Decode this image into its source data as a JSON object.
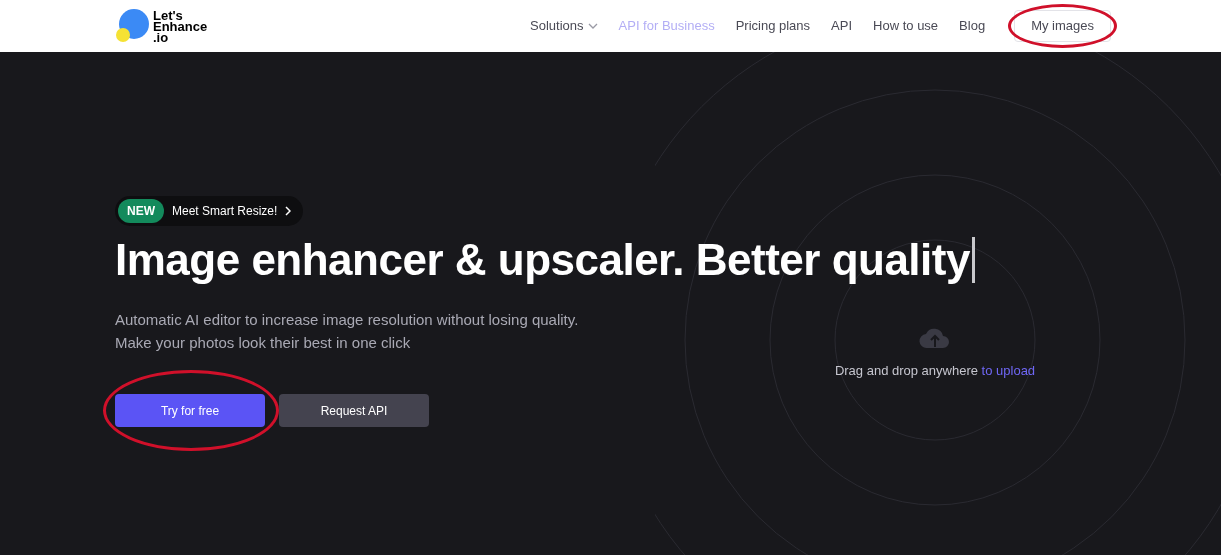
{
  "logo": {
    "text": "Let's\nEnhance\n.io"
  },
  "nav": [
    {
      "label": "Solutions",
      "kind": "dropdown",
      "selected": false
    },
    {
      "label": "API for Business",
      "kind": "link",
      "selected": true
    },
    {
      "label": "Pricing plans",
      "kind": "link",
      "selected": false
    },
    {
      "label": "API",
      "kind": "link",
      "selected": false
    },
    {
      "label": "How to use",
      "kind": "link",
      "selected": false
    },
    {
      "label": "Blog",
      "kind": "link",
      "selected": false
    },
    {
      "label": "My images",
      "kind": "button",
      "selected": false
    }
  ],
  "hero": {
    "badge": {
      "tag": "NEW",
      "text": "Meet Smart Resize!"
    },
    "title": "Image enhancer & upscaler. Better quality",
    "description": [
      "Automatic AI editor to increase image resolution without losing quality.",
      "Make your photos look their best in one click"
    ],
    "buttons": [
      {
        "label": "Try for free",
        "kind": "primary"
      },
      {
        "label": "Request API",
        "kind": "secondary"
      }
    ]
  },
  "upload": {
    "text": "Drag and drop anywhere",
    "link": "to upload"
  }
}
